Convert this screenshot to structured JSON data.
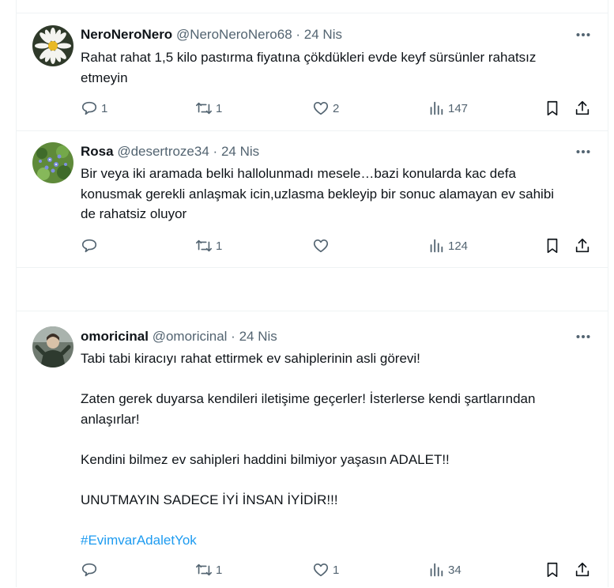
{
  "tweets": [
    {
      "display_name": "NeroNeroNero",
      "handle": "@NeroNeroNero68",
      "separator": "·",
      "date": "24 Nis",
      "text": [
        "Rahat rahat 1,5 kilo pastırma fiyatına çökdükleri evde keyf sürsünler rahatsız etmeyin"
      ],
      "reply_count": "1",
      "retweet_count": "1",
      "like_count": "2",
      "view_count": "147"
    },
    {
      "display_name": "Rosa",
      "handle": "@desertroze34",
      "separator": "·",
      "date": "24 Nis",
      "text": [
        "Bir veya iki aramada belki hallolunmadı mesele…bazi konularda kac defa konusmak gerekli anlaşmak icin,uzlasma bekleyip bir sonuc alamayan ev sahibi de rahatsiz oluyor"
      ],
      "reply_count": "",
      "retweet_count": "1",
      "like_count": "",
      "view_count": "124"
    },
    {
      "display_name": "omoricinal",
      "handle": "@omoricinal",
      "separator": "·",
      "date": "24 Nis",
      "text": [
        "Tabi tabi kiracıyı rahat ettirmek ev sahiplerinin asli görevi!",
        "Zaten gerek duyarsa kendileri iletişime geçerler! İsterlerse kendi şartlarından anlaşırlar!",
        "Kendini bilmez ev sahipleri haddini bilmiyor yaşasın ADALET!!",
        "UNUTMAYIN SADECE İYİ İNSAN İYİDİR!!!"
      ],
      "hashtag": "#EvimvarAdaletYok",
      "reply_count": "",
      "retweet_count": "1",
      "like_count": "1",
      "view_count": "34"
    }
  ],
  "icons": {
    "more": "more-horizontal-icon",
    "reply": "reply-bubble-icon",
    "retweet": "retweet-icon",
    "like": "heart-icon",
    "views": "bar-chart-icon",
    "bookmark": "bookmark-icon",
    "share": "share-upload-icon"
  },
  "colors": {
    "text": "#0f1419",
    "secondary": "#536471",
    "link": "#1d9bf0",
    "border": "#eff3f4"
  }
}
